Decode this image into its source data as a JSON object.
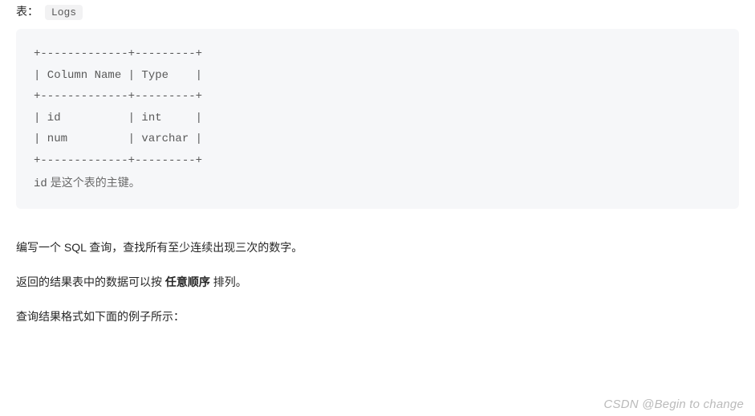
{
  "header": {
    "table_label": "表：",
    "table_name": "Logs"
  },
  "code_block": {
    "line1": "+-------------+---------+",
    "line2": "| Column Name | Type    |",
    "line3": "+-------------+---------+",
    "line4": "| id          | int     |",
    "line5": "| num         | varchar |",
    "line6": "+-------------+---------+",
    "note_id": "id",
    "note_text": " 是这个表的主键。"
  },
  "paragraphs": {
    "p1": "编写一个 SQL 查询，查找所有至少连续出现三次的数字。",
    "p2_before": "返回的结果表中的数据可以按 ",
    "p2_bold": "任意顺序",
    "p2_after": " 排列。",
    "p3": "查询结果格式如下面的例子所示："
  },
  "watermark": "CSDN @Begin to change"
}
